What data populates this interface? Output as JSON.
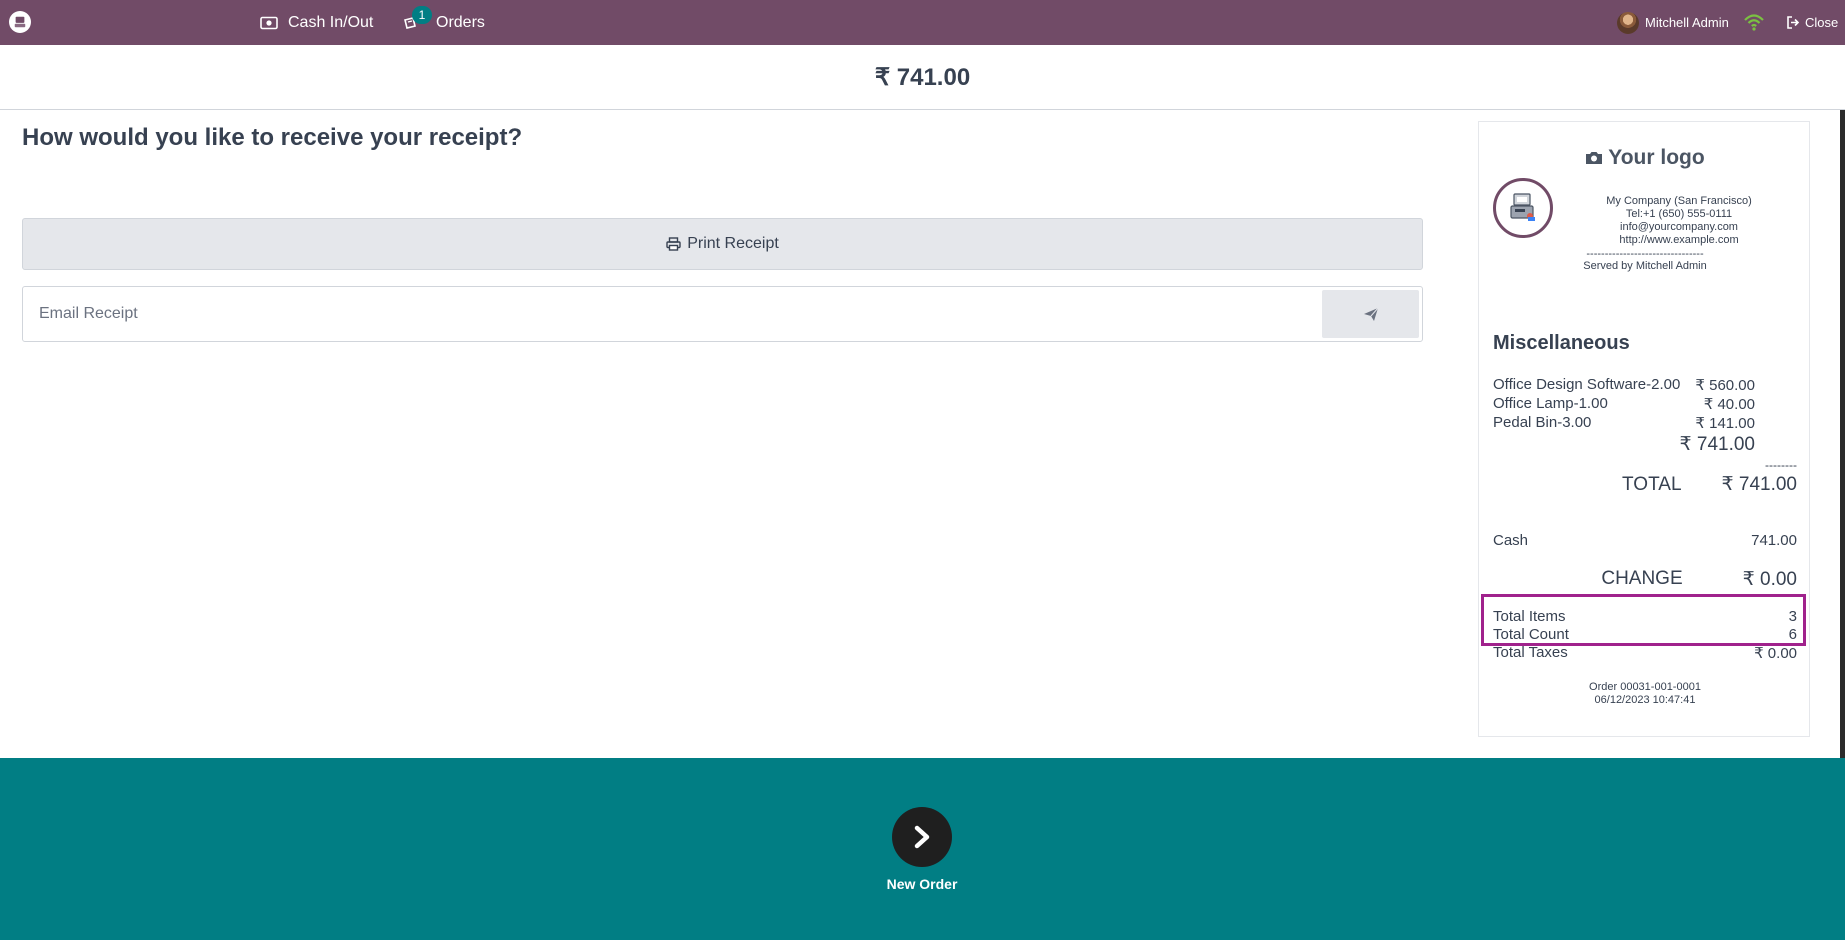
{
  "topbar": {
    "cash_in_out": "Cash In/Out",
    "orders_label": "Orders",
    "orders_badge": "1",
    "user_name": "Mitchell Admin",
    "close_label": "Close",
    "icons": [
      "pos-logo-icon",
      "cash-icon",
      "orders-icon",
      "wifi-icon",
      "close-icon"
    ],
    "bar_color": "#714b67"
  },
  "summary": {
    "amount": "₹ 741.00"
  },
  "receipt_options": {
    "question": "How would you like to receive your receipt?",
    "print_label": "Print Receipt",
    "email_placeholder": "Email Receipt",
    "email_value": ""
  },
  "receipt": {
    "logo_text": "Your logo",
    "company": {
      "name": "My Company (San Francisco)",
      "phone": "Tel:+1 (650) 555-0111",
      "email": "info@yourcompany.com",
      "website": "http://www.example.com",
      "separator": "--------------------------------",
      "served_by": "Served by Mitchell Admin"
    },
    "category": "Miscellaneous",
    "lines": [
      {
        "name": "Office Design Software-2.00",
        "price": "₹ 560.00"
      },
      {
        "name": "Office Lamp-1.00",
        "price": "₹ 40.00"
      },
      {
        "name": "Pedal Bin-3.00",
        "price": "₹ 141.00"
      }
    ],
    "subtotal": "₹ 741.00",
    "dashes": "--------",
    "total_label": "TOTAL",
    "total_value": "₹ 741.00",
    "payment_method": "Cash",
    "payment_amount": "741.00",
    "change_label": "CHANGE",
    "change_value": "₹ 0.00",
    "total_items_label": "Total Items",
    "total_items_value": "3",
    "total_count_label": "Total Count",
    "total_count_value": "6",
    "total_taxes_label": "Total Taxes",
    "total_taxes_value": "₹ 0.00",
    "order_ref": "Order 00031-001-0001",
    "order_date": "06/12/2023 10:47:41"
  },
  "footer": {
    "new_order_label": "New Order",
    "color": "#017e84"
  },
  "highlight_color": "#a0228c"
}
